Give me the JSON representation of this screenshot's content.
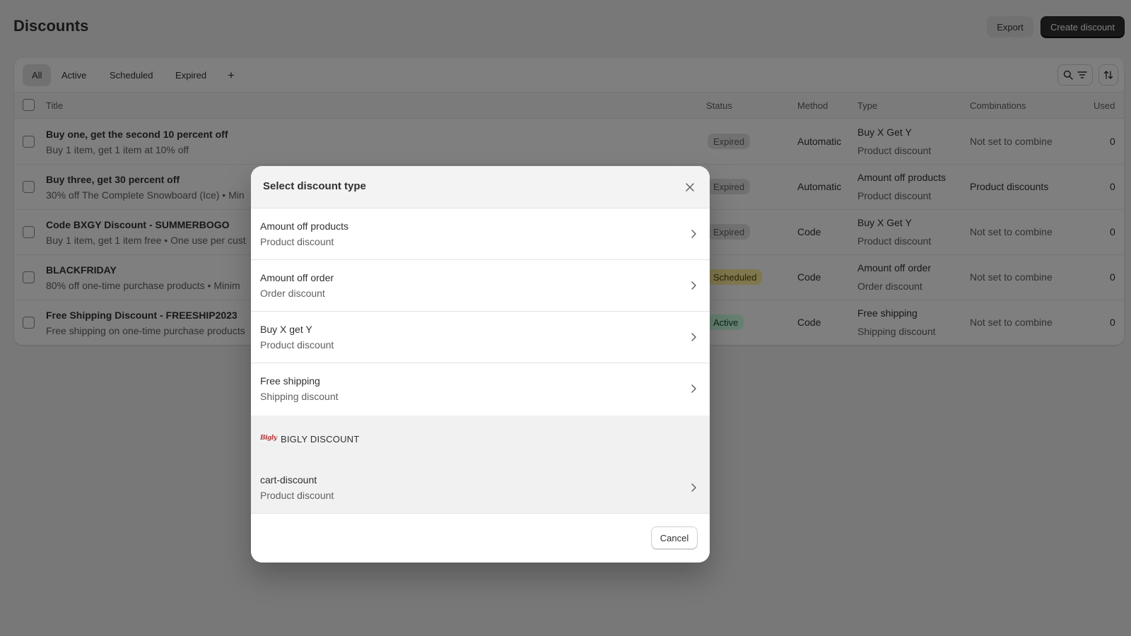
{
  "page": {
    "title": "Discounts",
    "export_label": "Export",
    "create_label": "Create discount"
  },
  "tabs": [
    {
      "label": "All",
      "selected": true
    },
    {
      "label": "Active",
      "selected": false
    },
    {
      "label": "Scheduled",
      "selected": false
    },
    {
      "label": "Expired",
      "selected": false
    },
    {
      "label": "+",
      "selected": false
    }
  ],
  "toolbar": {
    "search_filter_icon": "search-filter-icon",
    "sort_icon": "sort-icon"
  },
  "table": {
    "columns": [
      "Title",
      "Status",
      "Method",
      "Type",
      "Combinations",
      "Used"
    ],
    "rows": [
      {
        "title": "Buy one, get the second 10 percent off",
        "summary": "Buy 1 item, get 1 item at 10% off",
        "status": "Expired",
        "method": "Automatic",
        "type": "Buy X Get Y",
        "type_sub": "Product discount",
        "combinations": "Not set to combine",
        "used": "0"
      },
      {
        "title": "Buy three, get 30 percent off",
        "summary": "30% off The Complete Snowboard (Ice) • Min",
        "status": "Expired",
        "method": "Automatic",
        "type": "Amount off products",
        "type_sub": "Product discount",
        "combinations": "Product discounts",
        "used": "0"
      },
      {
        "title": "Code BXGY Discount - SUMMERBOGO",
        "summary": "Buy 1 item, get 1 item free • One use per cust",
        "status": "Expired",
        "method": "Code",
        "type": "Buy X Get Y",
        "type_sub": "Product discount",
        "combinations": "Not set to combine",
        "used": "0"
      },
      {
        "title": "BLACKFRIDAY",
        "summary": "80% off one-time purchase products • Minim",
        "status": "Scheduled",
        "method": "Code",
        "type": "Amount off order",
        "type_sub": "Order discount",
        "combinations": "Not set to combine",
        "used": "0"
      },
      {
        "title": "Free Shipping Discount - FREESHIP2023",
        "summary": "Free shipping on one-time purchase products",
        "status": "Active",
        "method": "Code",
        "type": "Free shipping",
        "type_sub": "Shipping discount",
        "combinations": "Not set to combine",
        "used": "0"
      }
    ]
  },
  "status_colors": {
    "Expired": "#e3e3e3",
    "Scheduled": "#ffef9d",
    "Active": "#cdfee1"
  },
  "modal": {
    "title": "Select discount type",
    "options": [
      {
        "title": "Amount off products",
        "subtitle": "Product discount"
      },
      {
        "title": "Amount off order",
        "subtitle": "Order discount"
      },
      {
        "title": "Buy X get Y",
        "subtitle": "Product discount"
      },
      {
        "title": "Free shipping",
        "subtitle": "Shipping discount"
      }
    ],
    "app_section": {
      "logo_text": "Bigly",
      "name": "BIGLY DISCOUNT",
      "options": [
        {
          "title": "cart-discount",
          "subtitle": "Product discount"
        }
      ]
    },
    "cancel_label": "Cancel"
  }
}
